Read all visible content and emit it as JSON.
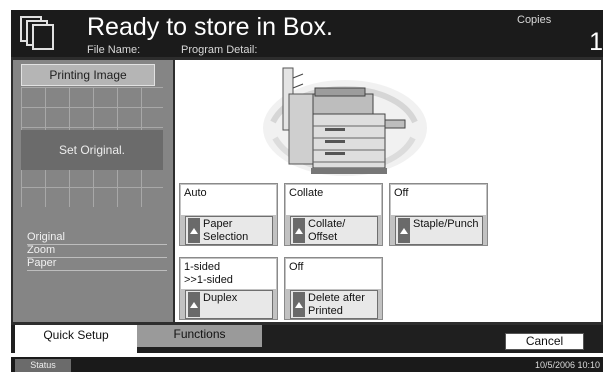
{
  "header": {
    "title": "Ready to store in Box.",
    "file_name_label": "File Name:",
    "program_detail_label": "Program Detail:",
    "copies_label": "Copies",
    "copies_count": "1"
  },
  "preview": {
    "title": "Printing Image",
    "placeholder": "Set Original.",
    "info_labels": [
      "Original",
      "Zoom",
      "Paper"
    ]
  },
  "functions": [
    {
      "value": "Auto",
      "label": "Paper\nSelection"
    },
    {
      "value": "Collate",
      "label": "Collate/\nOffset"
    },
    {
      "value": "Off",
      "label": "Staple/Punch"
    },
    {
      "value": "1-sided\n>>1-sided",
      "label": "Duplex"
    },
    {
      "value": "Off",
      "label": "Delete after\nPrinted"
    }
  ],
  "tabs": {
    "quick_setup": "Quick Setup",
    "functions": "Functions"
  },
  "cancel_label": "Cancel",
  "status_label": "Status",
  "datetime": "10/5/2006   10:10"
}
